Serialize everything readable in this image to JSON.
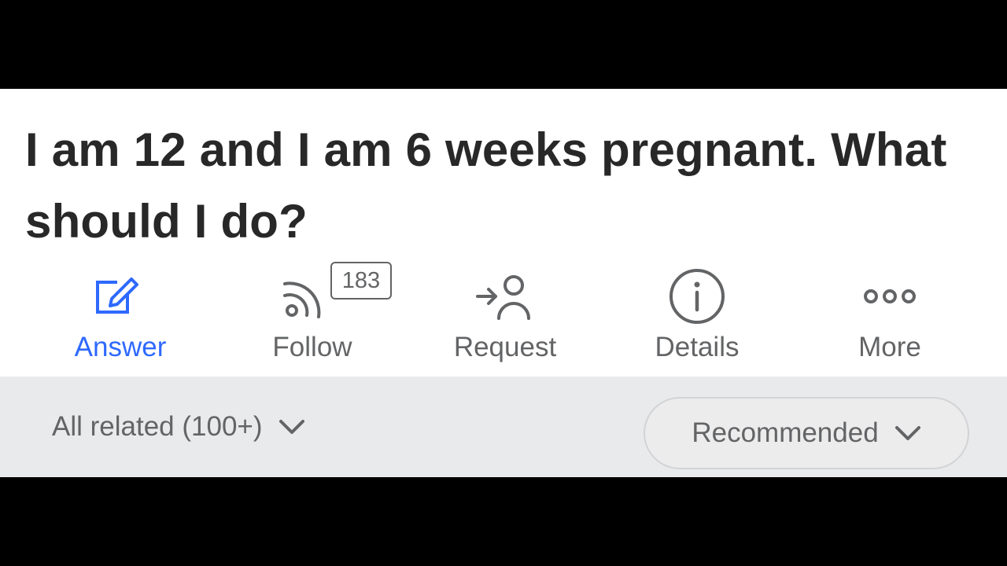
{
  "question": {
    "title": "I am 12 and I am 6 weeks pregnant. What should I do?"
  },
  "actions": [
    {
      "label": "Answer",
      "icon": "edit-pencil-icon",
      "active": true
    },
    {
      "label": "Follow",
      "icon": "rss-follow-icon",
      "count": "183"
    },
    {
      "label": "Request",
      "icon": "request-user-icon"
    },
    {
      "label": "Details",
      "icon": "info-icon"
    },
    {
      "label": "More",
      "icon": "more-dots-icon"
    }
  ],
  "filter": {
    "related_label": "All related (100+)",
    "sort_label": "Recommended",
    "chevron_icon": "chevron-down-icon"
  },
  "colors": {
    "accent": "#2e69ff",
    "text_primary": "#282829",
    "text_secondary": "#636466",
    "filter_background": "#e9eaeb"
  }
}
